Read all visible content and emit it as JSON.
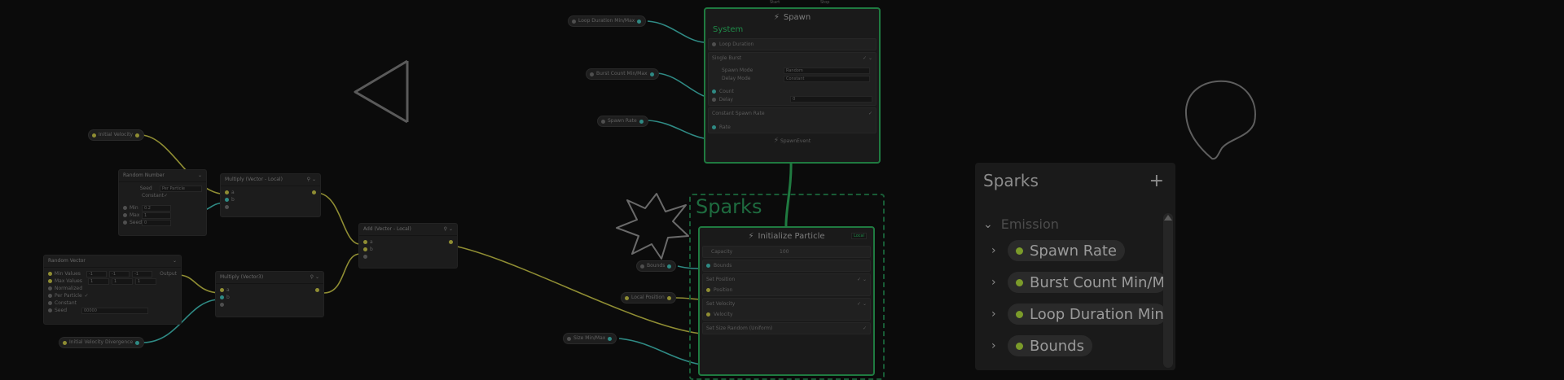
{
  "colors": {
    "wire_yellow": "#8f8d33",
    "wire_cyan": "#2f8a84",
    "context_green": "#1f7a40",
    "bg": "#0b0b0b"
  },
  "pills": {
    "initial_velocity": "Initial Velocity",
    "initial_velocity_divergence": "Initial Velocity Divergence",
    "loop_duration": "Loop Duration Min/Max",
    "burst_count": "Burst Count Min/Max",
    "spawn_rate": "Spawn Rate",
    "bounds": "Bounds",
    "local_position": "Local Position",
    "size_minmax": "Size Min/Max"
  },
  "random_number": {
    "title": "Random Number",
    "seed_label": "Seed",
    "seed_value": "Per Particle",
    "constant_label": "Constant",
    "min_label": "Min",
    "min_value": "0.2",
    "max_label": "Max",
    "max_value": "1",
    "seed2_label": "Seed",
    "seed2_value": "0"
  },
  "random_vector": {
    "title": "Random Vector",
    "min_label": "Min Values",
    "min_x": "-1",
    "min_y": "-1",
    "min_z": "-1",
    "max_label": "Max Values",
    "max_x": "1",
    "max_y": "1",
    "max_z": "1",
    "opt1": "Normalized",
    "opt2": "Per Particle",
    "opt3": "Constant",
    "seed_label": "Seed",
    "seed_value": "00000",
    "output": "Output"
  },
  "multiply_local": {
    "title": "Multiply (Vector - Local)",
    "a": "a",
    "b": "b"
  },
  "multiply2": {
    "title": "Multiply (Vector3)",
    "a": "a",
    "b": "b"
  },
  "add_local": {
    "title": "Add (Vector - Local)",
    "a": "a",
    "b": "b"
  },
  "spawn": {
    "title": "Spawn",
    "start": "Start",
    "stop": "Stop",
    "system": "System",
    "loop_duration": "Loop Duration",
    "single_burst": "Single Burst",
    "spawn_mode": "Spawn Mode",
    "spawn_mode_value": "Random",
    "delay_mode": "Delay Mode",
    "delay_mode_value": "Constant",
    "count": "Count",
    "delay": "Delay",
    "delay_value": "0",
    "constant_rate": "Constant Spawn Rate",
    "rate": "Rate",
    "event": "SpawnEvent"
  },
  "init": {
    "title": "Initialize Particle",
    "badge": "Local",
    "capacity": "Capacity",
    "capacity_value": "100",
    "bounds": "Bounds",
    "set_position": "Set Position",
    "position": "Position",
    "set_velocity": "Set Velocity",
    "velocity": "Velocity",
    "set_size": "Set Size Random (Uniform)"
  },
  "sticky": {
    "sparks": "Sparks"
  },
  "blackboard": {
    "title": "Sparks",
    "plus": "+",
    "section": "Emission",
    "items": [
      {
        "label": "Spawn Rate"
      },
      {
        "label": "Burst Count Min/Max"
      },
      {
        "label": "Loop Duration Min/M"
      },
      {
        "label": "Bounds"
      }
    ]
  }
}
